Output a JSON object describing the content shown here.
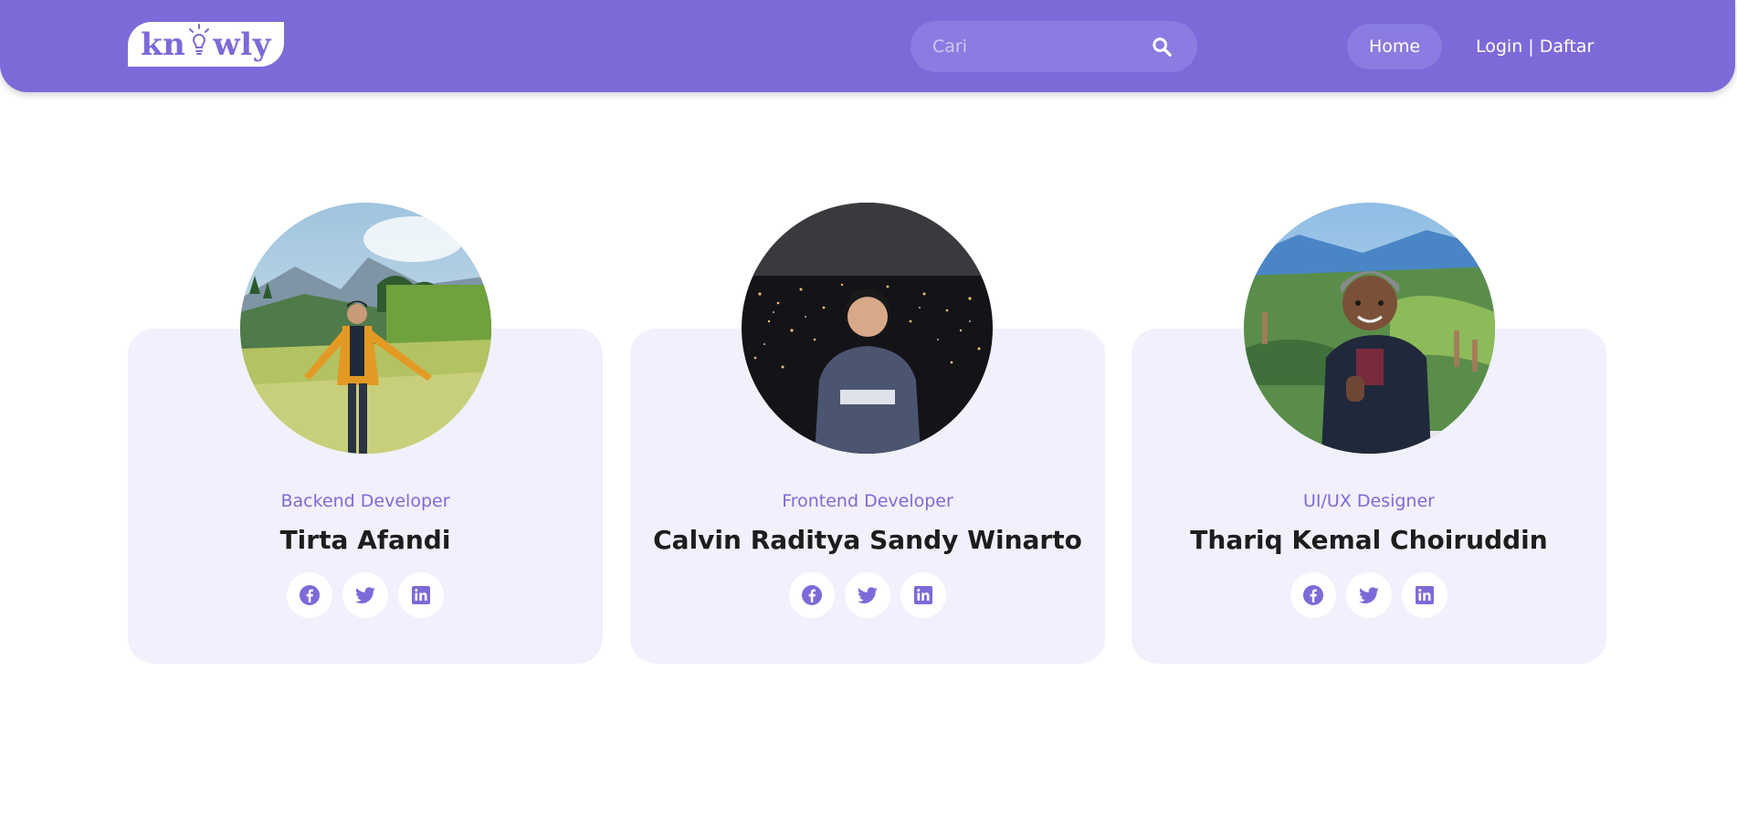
{
  "navbar": {
    "logo_text_left": "kn",
    "logo_text_right": "wly",
    "search_placeholder": "Cari",
    "home_label": "Home",
    "login_label": "Login | Daftar"
  },
  "team": [
    {
      "role": "Backend Developer",
      "name": "Tirta Afandi"
    },
    {
      "role": "Frontend Developer",
      "name": "Calvin Raditya Sandy Winarto"
    },
    {
      "role": "UI/UX Designer",
      "name": "Thariq Kemal Choiruddin"
    }
  ],
  "icons": {
    "search": "search-icon",
    "facebook": "facebook-icon",
    "twitter": "twitter-icon",
    "linkedin": "linkedin-icon",
    "logo_bulb": "lightbulb-icon"
  },
  "colors": {
    "brand": "#7b6bd9",
    "card_bg": "#f1f0fd",
    "text_dark": "#1d1d1d"
  }
}
